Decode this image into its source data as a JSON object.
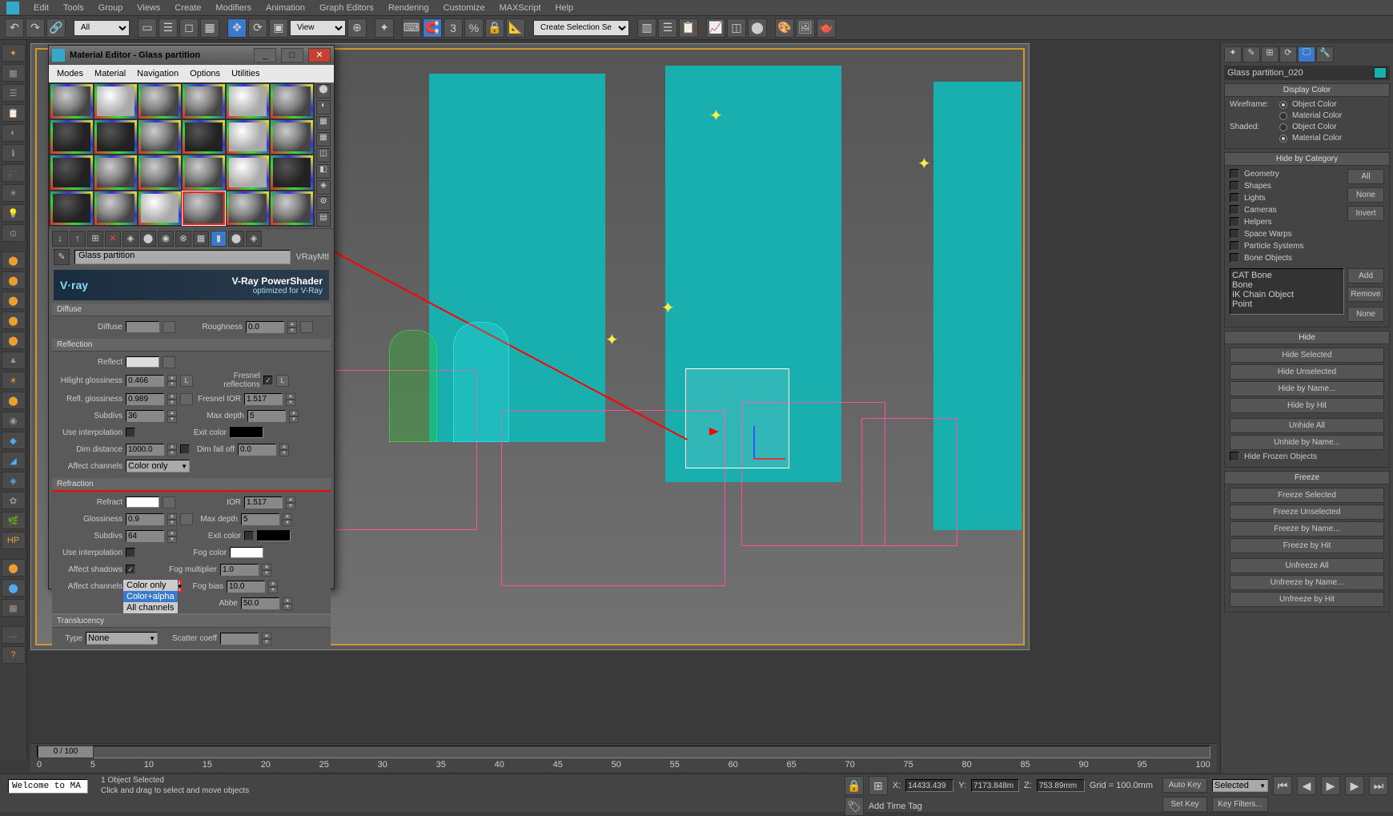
{
  "app": {
    "logo": "3ds"
  },
  "menu": [
    "Edit",
    "Tools",
    "Group",
    "Views",
    "Create",
    "Modifiers",
    "Animation",
    "Graph Editors",
    "Rendering",
    "Customize",
    "MAXScript",
    "Help"
  ],
  "toolbar": {
    "all_dropdown": "All",
    "view_dropdown": "View",
    "selection_set": "Create Selection Se"
  },
  "material_editor": {
    "title": "Material Editor - Glass partition",
    "menu": [
      "Modes",
      "Material",
      "Navigation",
      "Options",
      "Utilities"
    ],
    "material_name": "Glass partition",
    "material_type": "VRayMtl",
    "vray": {
      "logo": "V·ray",
      "main": "V-Ray PowerShader",
      "sub": "optimized for V-Ray"
    },
    "diffuse": {
      "head": "Diffuse",
      "diffuse_label": "Diffuse",
      "roughness_label": "Roughness",
      "roughness_val": "0.0"
    },
    "reflection": {
      "head": "Reflection",
      "reflect_label": "Reflect",
      "hilight_gloss_label": "Hilight glossiness",
      "hilight_gloss_val": "0.466",
      "l1_label": "L",
      "fresnel_label": "Fresnel reflections",
      "l2_label": "L",
      "refl_gloss_label": "Refl. glossiness",
      "refl_gloss_val": "0.989",
      "fresnel_ior_label": "Fresnel IOR",
      "fresnel_ior_val": "1.517",
      "subdivs_label": "Subdivs",
      "subdivs_val": "36",
      "max_depth_label": "Max depth",
      "max_depth_val": "5",
      "use_interp_label": "Use interpolation",
      "exit_color_label": "Exit color",
      "dim_dist_label": "Dim distance",
      "dim_dist_val": "1000.0",
      "dim_falloff_label": "Dim fall off",
      "dim_falloff_val": "0.0",
      "affect_channels_label": "Affect channels",
      "affect_channels_val": "Color only"
    },
    "refraction": {
      "head": "Refraction",
      "refract_label": "Refract",
      "ior_label": "IOR",
      "ior_val": "1.517",
      "gloss_label": "Glossiness",
      "gloss_val": "0.9",
      "max_depth_label": "Max depth",
      "max_depth_val": "5",
      "subdivs_label": "Subdivs",
      "subdivs_val": "64",
      "exit_color_label": "Exit color",
      "use_interp_label": "Use interpolation",
      "fog_color_label": "Fog color",
      "affect_shadows_label": "Affect shadows",
      "fog_mult_label": "Fog multiplier",
      "fog_mult_val": "1.0",
      "affect_channels_label": "Affect channels",
      "affect_channels_val": "Color+alpha",
      "fog_bias_label": "Fog bias",
      "fog_bias_val": "10.0",
      "abbe_label": "Abbe",
      "abbe_val": "50.0",
      "dropdown_options": [
        "Color only",
        "Color+alpha",
        "All channels"
      ],
      "dropdown_selected": "Color+alpha"
    },
    "translucency": {
      "head": "Translucency",
      "type_label": "Type",
      "type_val": "None",
      "scatter_label": "Scatter coeff"
    }
  },
  "right_panel": {
    "object_name": "Glass partition_020",
    "display_color": {
      "head": "Display Color",
      "wireframe": "Wireframe:",
      "shaded": "Shaded:",
      "object_color": "Object Color",
      "material_color": "Material Color"
    },
    "hide_category": {
      "head": "Hide by Category",
      "items": [
        "Geometry",
        "Shapes",
        "Lights",
        "Cameras",
        "Helpers",
        "Space Warps",
        "Particle Systems",
        "Bone Objects"
      ],
      "buttons": [
        "All",
        "None",
        "Invert"
      ],
      "list_items": [
        "CAT Bone",
        "Bone",
        "IK Chain Object",
        "Point"
      ],
      "add": "Add",
      "remove": "Remove",
      "none": "None"
    },
    "hide": {
      "head": "Hide",
      "buttons": [
        "Hide Selected",
        "Hide Unselected",
        "Hide by Name...",
        "Hide by Hit",
        "Unhide All",
        "Unhide by Name..."
      ],
      "frozen": "Hide Frozen Objects"
    },
    "freeze": {
      "head": "Freeze",
      "buttons": [
        "Freeze Selected",
        "Freeze Unselected",
        "Freeze by Name...",
        "Freeze by Hit",
        "Unfreeze All",
        "Unfreeze by Name...",
        "Unfreeze by Hit"
      ]
    }
  },
  "timeline": {
    "handle": "0 / 100",
    "ticks": [
      "0",
      "5",
      "10",
      "15",
      "20",
      "25",
      "30",
      "35",
      "40",
      "45",
      "50",
      "55",
      "60",
      "65",
      "70",
      "75",
      "80",
      "85",
      "90",
      "95",
      "100"
    ]
  },
  "status": {
    "welcome": "Welcome to MA",
    "sel_count": "1 Object Selected",
    "hint": "Click and drag to select and move objects",
    "x_label": "X:",
    "x_val": "14433.439",
    "y_label": "Y:",
    "y_val": "7173.848m",
    "z_label": "Z:",
    "z_val": "753.89mm",
    "grid": "Grid = 100.0mm",
    "add_time_tag": "Add Time Tag",
    "auto_key": "Auto Key",
    "set_key": "Set Key",
    "selected": "Selected",
    "key_filters": "Key Filters..."
  }
}
